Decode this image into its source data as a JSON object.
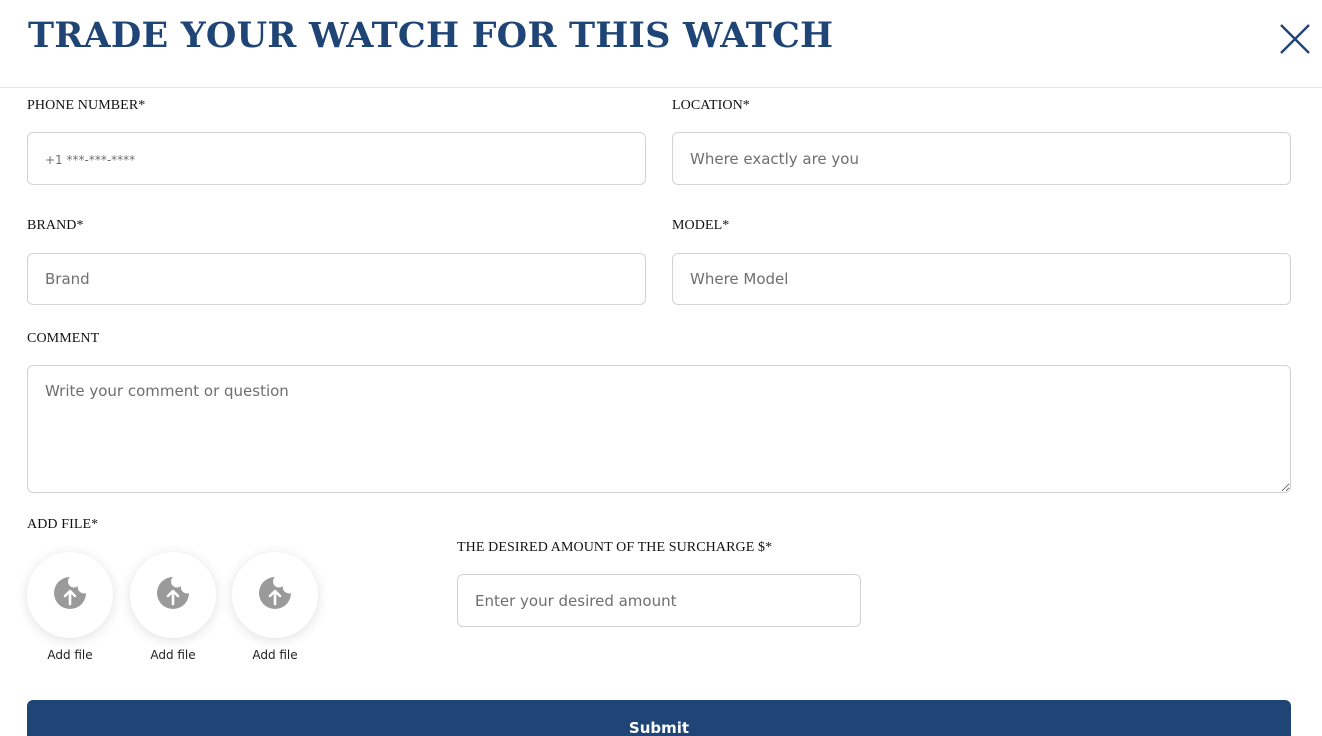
{
  "dialog": {
    "title": "TRADE YOUR WATCH FOR THIS WATCH",
    "close_icon": "close-icon"
  },
  "form": {
    "phone": {
      "label": "PHONE NUMBER*",
      "placeholder": "+1 ***-***-****"
    },
    "location": {
      "label": "LOCATION*",
      "placeholder": "Where exactly are you"
    },
    "brand": {
      "label": "BRAND*",
      "placeholder": "Brand"
    },
    "model": {
      "label": "MODEL*",
      "placeholder": "Where Model"
    },
    "comment": {
      "label": "COMMENT",
      "placeholder": "Write your comment or question"
    },
    "add_file": {
      "label": "ADD FILE*",
      "slots": [
        {
          "label": "Add file",
          "icon": "upload-icon"
        },
        {
          "label": "Add file",
          "icon": "upload-icon"
        },
        {
          "label": "Add file",
          "icon": "upload-icon"
        }
      ]
    },
    "surcharge": {
      "label": "THE DESIRED AMOUNT OF THE SURCHARGE $*",
      "placeholder": "Enter your desired amount"
    },
    "submit_label": "Submit"
  },
  "colors": {
    "brand_navy": "#1f4476",
    "upload_icon_gray": "#9a9a9a",
    "border": "#d3d3d3"
  }
}
